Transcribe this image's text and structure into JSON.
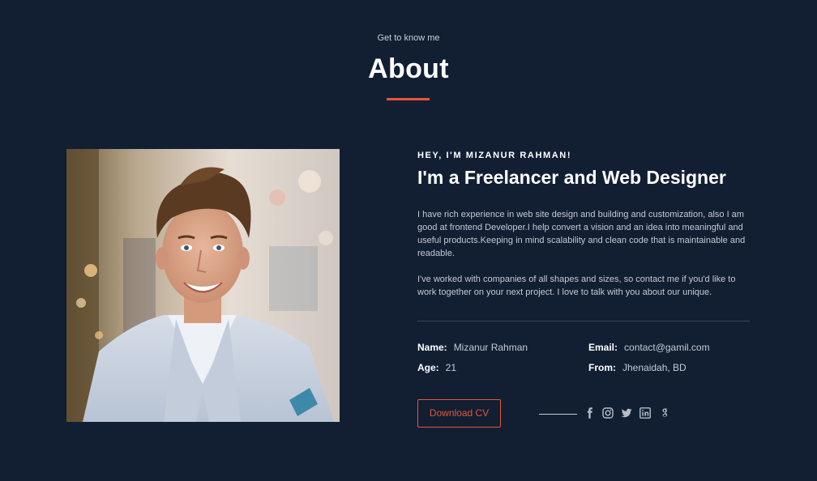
{
  "section": {
    "eyebrow": "Get to know me",
    "title": "About"
  },
  "about": {
    "greeting": "HEY, I'M MIZANUR RAHMAN!",
    "headline": "I'm a Freelancer and Web Designer",
    "paragraph_1": "I have rich experience in web site design and building and customization, also I am good at frontend Developer.I help convert a vision and an idea into meaningful and useful products.Keeping in mind scalability and clean code that is maintainable and readable.",
    "paragraph_2": "I've worked with companies of all shapes and sizes, so contact me if you'd like to work together on your next project. I love to talk with you about our unique."
  },
  "info": {
    "name_label": "Name:",
    "name_value": "Mizanur Rahman",
    "age_label": "Age:",
    "age_value": "21",
    "email_label": "Email:",
    "email_value": "contact@gamil.com",
    "from_label": "From:",
    "from_value": "Jhenaidah, BD"
  },
  "actions": {
    "download_cv": "Download CV"
  },
  "social_icons": [
    "facebook-icon",
    "instagram-icon",
    "twitter-icon",
    "linkedin-icon",
    "google-icon"
  ],
  "colors": {
    "background": "#121f33",
    "accent": "#e8553a",
    "heading": "#ffffff",
    "body_text": "#c4c9d3"
  }
}
